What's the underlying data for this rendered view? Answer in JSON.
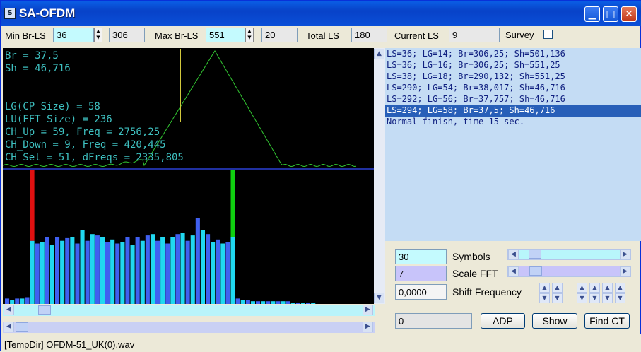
{
  "window": {
    "title": "SA-OFDM",
    "app_icon": "analyzer-icon",
    "title_color": "#0a4fd8"
  },
  "toolbar": {
    "min_br_ls_label": "Min Br-LS",
    "min_br_ls_value": "36",
    "min_br_ls_extra": "306",
    "max_br_ls_label": "Max Br-LS",
    "max_br_ls_value": "551",
    "max_br_ls_extra": "20",
    "total_ls_label": "Total LS",
    "total_ls_value": "180",
    "current_ls_label": "Current LS",
    "current_ls_value": "9",
    "survey_label": "Survey",
    "survey_checked": false
  },
  "scope": {
    "lines": [
      "Br = 37,5",
      "Sh = 46,716",
      "LG(CP Size) = 58",
      "LU(FFT Size) = 236",
      "CH_Up = 59, Freq = 2756,25",
      "CH_Down = 9, Freq = 420,445",
      "CH_Sel = 51, dFreqs = 2335,805"
    ],
    "curve_color": "#32c832",
    "marker_color": "#d2c83c"
  },
  "spectrum": {
    "bars": [
      0.04,
      0.03,
      0.04,
      0.04,
      0.05,
      0.47,
      0.45,
      0.46,
      0.5,
      0.44,
      0.5,
      0.47,
      0.49,
      0.5,
      0.45,
      0.55,
      0.47,
      0.52,
      0.51,
      0.5,
      0.46,
      0.48,
      0.45,
      0.46,
      0.5,
      0.44,
      0.5,
      0.47,
      0.51,
      0.52,
      0.47,
      0.5,
      0.45,
      0.5,
      0.52,
      0.53,
      0.47,
      0.51,
      0.64,
      0.55,
      0.52,
      0.46,
      0.48,
      0.45,
      0.46,
      0.5,
      0.04,
      0.03,
      0.03,
      0.02,
      0.02,
      0.02,
      0.02,
      0.02,
      0.02,
      0.02,
      0.02,
      0.01,
      0.01,
      0.01,
      0.01,
      0.01
    ],
    "marker_left_index": 5,
    "marker_right_index": 45,
    "bar_color": "#4060f0",
    "alt_color": "#20d8f0",
    "marker_left_color": "#e01010",
    "marker_right_color": "#10d010"
  },
  "log": {
    "lines": [
      "LS=36; LG=14; Br=306,25; Sh=501,136",
      "LS=36; LG=16; Br=306,25; Sh=551,25",
      "LS=38; LG=18; Br=290,132; Sh=551,25",
      "LS=290; LG=54; Br=38,017; Sh=46,716",
      "LS=292; LG=56; Br=37,757; Sh=46,716",
      "LS=294; LG=58; Br=37,5; Sh=46,716",
      "Normal finish, time 15 sec."
    ],
    "selected_index": 5
  },
  "controls": {
    "symbols_value": "30",
    "symbols_label": "Symbols",
    "symbols_slider": 0.09,
    "scale_fft_value": "7",
    "scale_fft_label": "Scale FFT",
    "scale_fft_slider": 0.1,
    "shift_value": "0,0000",
    "shift_label": "Shift Frequency",
    "result_value": "0",
    "adp_label": "ADP",
    "show_label": "Show",
    "find_ct_label": "Find CT"
  },
  "status": {
    "text": "[TempDir] OFDM-51_UK(0).wav"
  }
}
